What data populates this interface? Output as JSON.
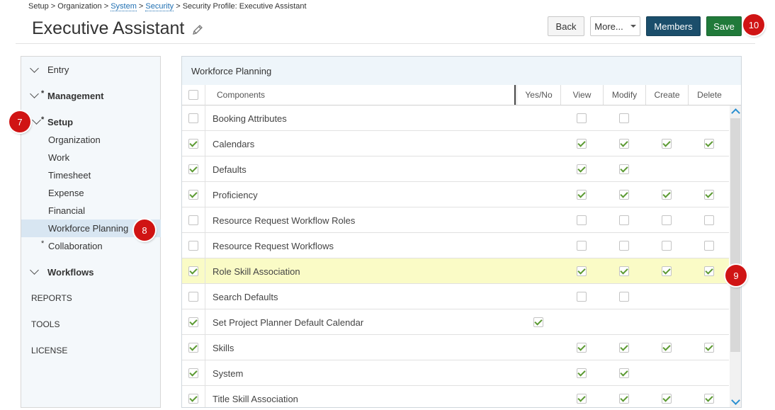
{
  "breadcrumb": {
    "part1": "Setup > Organization > ",
    "link1": "System",
    "sep1": " > ",
    "link2": "Security",
    "part2": " > Security Profile: Executive Assistant"
  },
  "page_title": "Executive Assistant",
  "toolbar": {
    "back_label": "Back",
    "more_label": "More...",
    "members_label": "Members",
    "save_label": "Save"
  },
  "badges": {
    "b7": "7",
    "b8": "8",
    "b9": "9",
    "b10": "10"
  },
  "sidebar": {
    "entry": "Entry",
    "management_star": "*",
    "management": "Management",
    "setup_star": "*",
    "setup": "Setup",
    "setup_children": {
      "organization": "Organization",
      "work": "Work",
      "timesheet": "Timesheet",
      "expense": "Expense",
      "financial": "Financial",
      "workforce_planning": "Workforce Planning"
    },
    "collaboration_star": "*",
    "collaboration": "Collaboration",
    "workflows": "Workflows",
    "reports": "REPORTS",
    "tools": "TOOLS",
    "license": "LICENSE"
  },
  "panel": {
    "title": "Workforce Planning",
    "columns": {
      "components": "Components",
      "yesno": "Yes/No",
      "view": "View",
      "modify": "Modify",
      "create": "Create",
      "delete": "Delete"
    }
  },
  "rows": [
    {
      "label": "Booking Attributes",
      "select": false,
      "yesno": null,
      "view": false,
      "modify": false,
      "create": null,
      "delete": null,
      "highlight": false
    },
    {
      "label": "Calendars",
      "select": true,
      "yesno": null,
      "view": true,
      "modify": true,
      "create": true,
      "delete": true,
      "highlight": false
    },
    {
      "label": "Defaults",
      "select": true,
      "yesno": null,
      "view": true,
      "modify": true,
      "create": null,
      "delete": null,
      "highlight": false
    },
    {
      "label": "Proficiency",
      "select": true,
      "yesno": null,
      "view": true,
      "modify": true,
      "create": true,
      "delete": true,
      "highlight": false
    },
    {
      "label": "Resource Request Workflow Roles",
      "select": false,
      "yesno": null,
      "view": false,
      "modify": false,
      "create": false,
      "delete": false,
      "highlight": false
    },
    {
      "label": "Resource Request Workflows",
      "select": false,
      "yesno": null,
      "view": false,
      "modify": false,
      "create": false,
      "delete": false,
      "highlight": false
    },
    {
      "label": "Role Skill Association",
      "select": true,
      "yesno": null,
      "view": true,
      "modify": true,
      "create": true,
      "delete": true,
      "highlight": true
    },
    {
      "label": "Search Defaults",
      "select": false,
      "yesno": null,
      "view": false,
      "modify": false,
      "create": null,
      "delete": null,
      "highlight": false
    },
    {
      "label": "Set Project Planner Default Calendar",
      "select": true,
      "yesno": true,
      "view": null,
      "modify": null,
      "create": null,
      "delete": null,
      "highlight": false
    },
    {
      "label": "Skills",
      "select": true,
      "yesno": null,
      "view": true,
      "modify": true,
      "create": true,
      "delete": true,
      "highlight": false
    },
    {
      "label": "System",
      "select": true,
      "yesno": null,
      "view": true,
      "modify": true,
      "create": null,
      "delete": null,
      "highlight": false
    },
    {
      "label": "Title Skill Association",
      "select": true,
      "yesno": null,
      "view": true,
      "modify": true,
      "create": true,
      "delete": true,
      "highlight": false
    }
  ],
  "colors": {
    "members_button": "#1b4e6b",
    "save_button": "#207a3a",
    "badge": "#d01414",
    "check": "#5c9a33",
    "highlight_row": "#fafbc6",
    "selected_nav": "#d8e6f2"
  },
  "icons": {
    "edit": "pencil-icon",
    "expand": "chevron-down-icon",
    "dropdown": "caret-down-icon",
    "scroll_up": "chevron-up-icon",
    "scroll_down": "chevron-down-icon"
  }
}
